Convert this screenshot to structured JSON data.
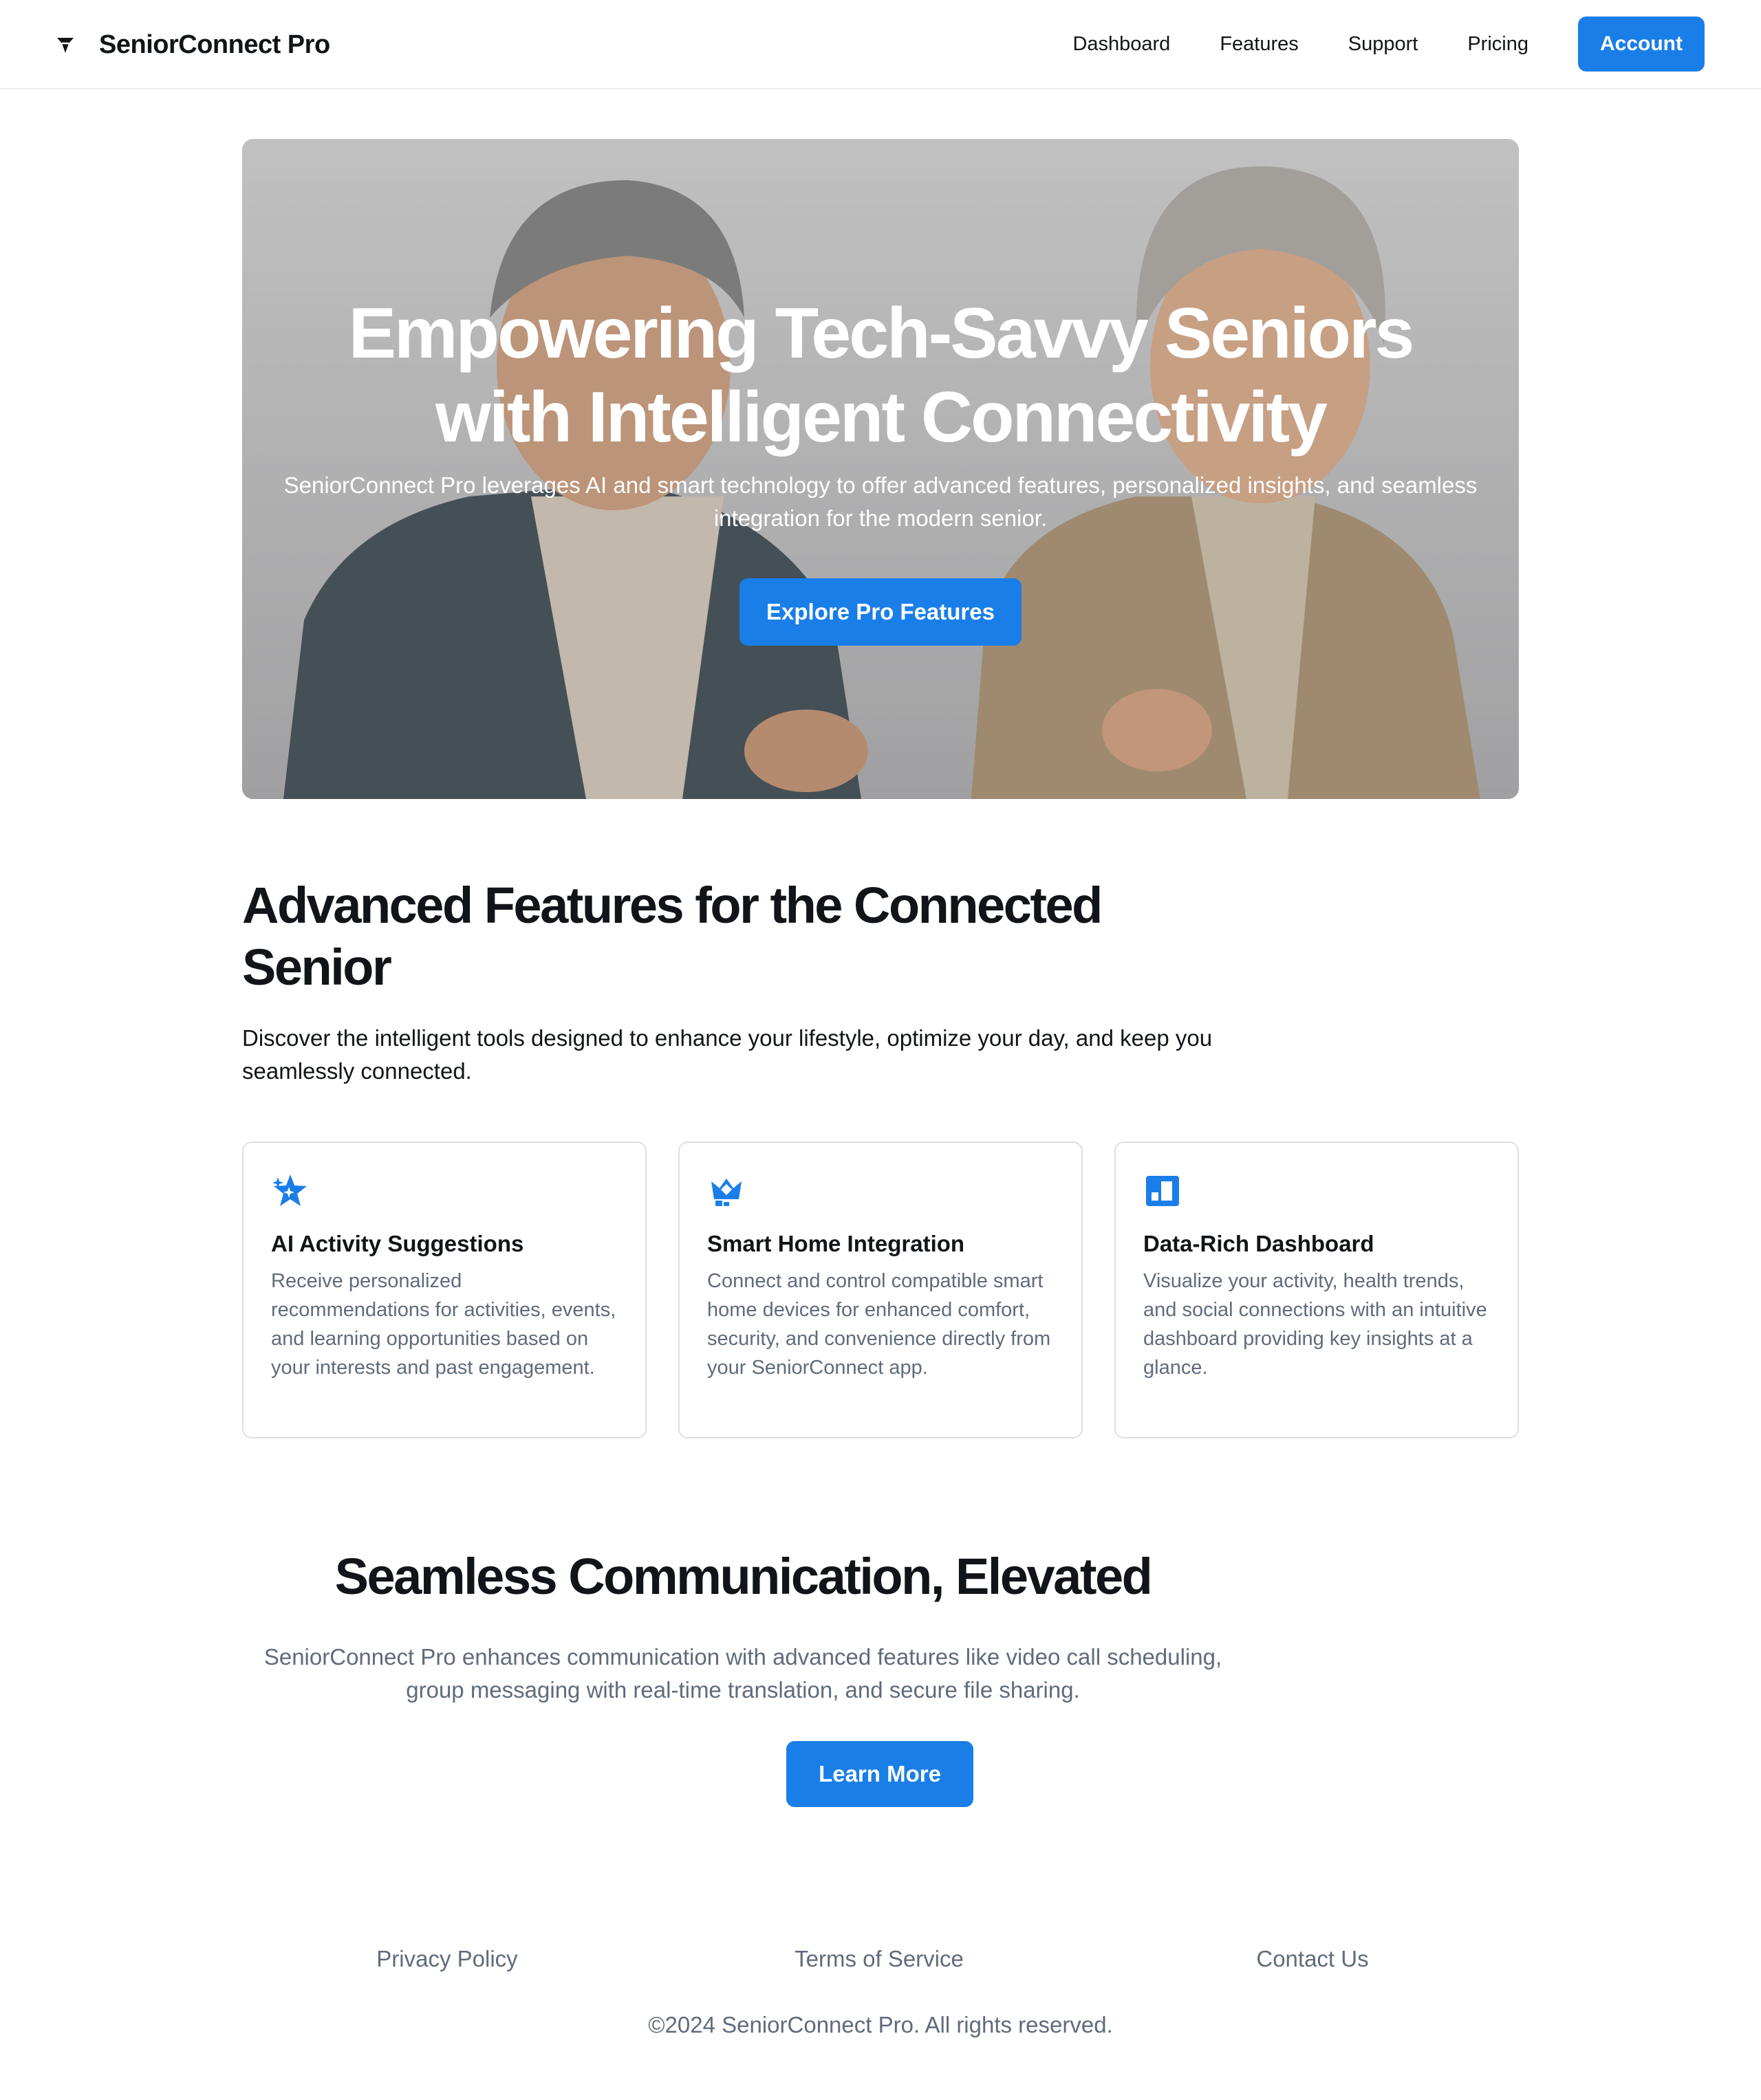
{
  "header": {
    "brand": "SeniorConnect Pro",
    "nav": [
      "Dashboard",
      "Features",
      "Support",
      "Pricing"
    ],
    "account_label": "Account"
  },
  "hero": {
    "title": "Empowering Tech-Savvy Seniors with Intelligent Connectivity",
    "subtitle": "SeniorConnect Pro leverages AI and smart technology to offer advanced features, personalized insights, and seamless integration for the modern senior.",
    "cta": "Explore Pro Features"
  },
  "features": {
    "title": "Advanced Features for the Connected Senior",
    "subtitle": "Discover the intelligent tools designed to enhance your lifestyle, optimize your day, and keep you seamlessly connected.",
    "cards": [
      {
        "icon": "sparkle-star-icon",
        "title": "AI Activity Suggestions",
        "description": "Receive personalized recommendations for activities, events, and learning opportunities based on your interests and past engagement."
      },
      {
        "icon": "smart-home-icon",
        "title": "Smart Home Integration",
        "description": "Connect and control compatible smart home devices for enhanced comfort, security, and convenience directly from your SeniorConnect app."
      },
      {
        "icon": "dashboard-icon",
        "title": "Data-Rich Dashboard",
        "description": "Visualize your activity, health trends, and social connections with an intuitive dashboard providing key insights at a glance."
      }
    ]
  },
  "communication": {
    "title": "Seamless Communication, Elevated",
    "subtitle": "SeniorConnect Pro enhances communication with advanced features like video call scheduling, group messaging with real-time translation, and secure file sharing.",
    "cta": "Learn More"
  },
  "footer": {
    "links": [
      "Privacy Policy",
      "Terms of Service",
      "Contact Us"
    ],
    "copyright": "©2024 SeniorConnect Pro. All rights reserved."
  },
  "colors": {
    "accent": "#1a7ee8",
    "text": "#111418",
    "muted": "#5f6b7c",
    "border": "#dcdfe4"
  }
}
